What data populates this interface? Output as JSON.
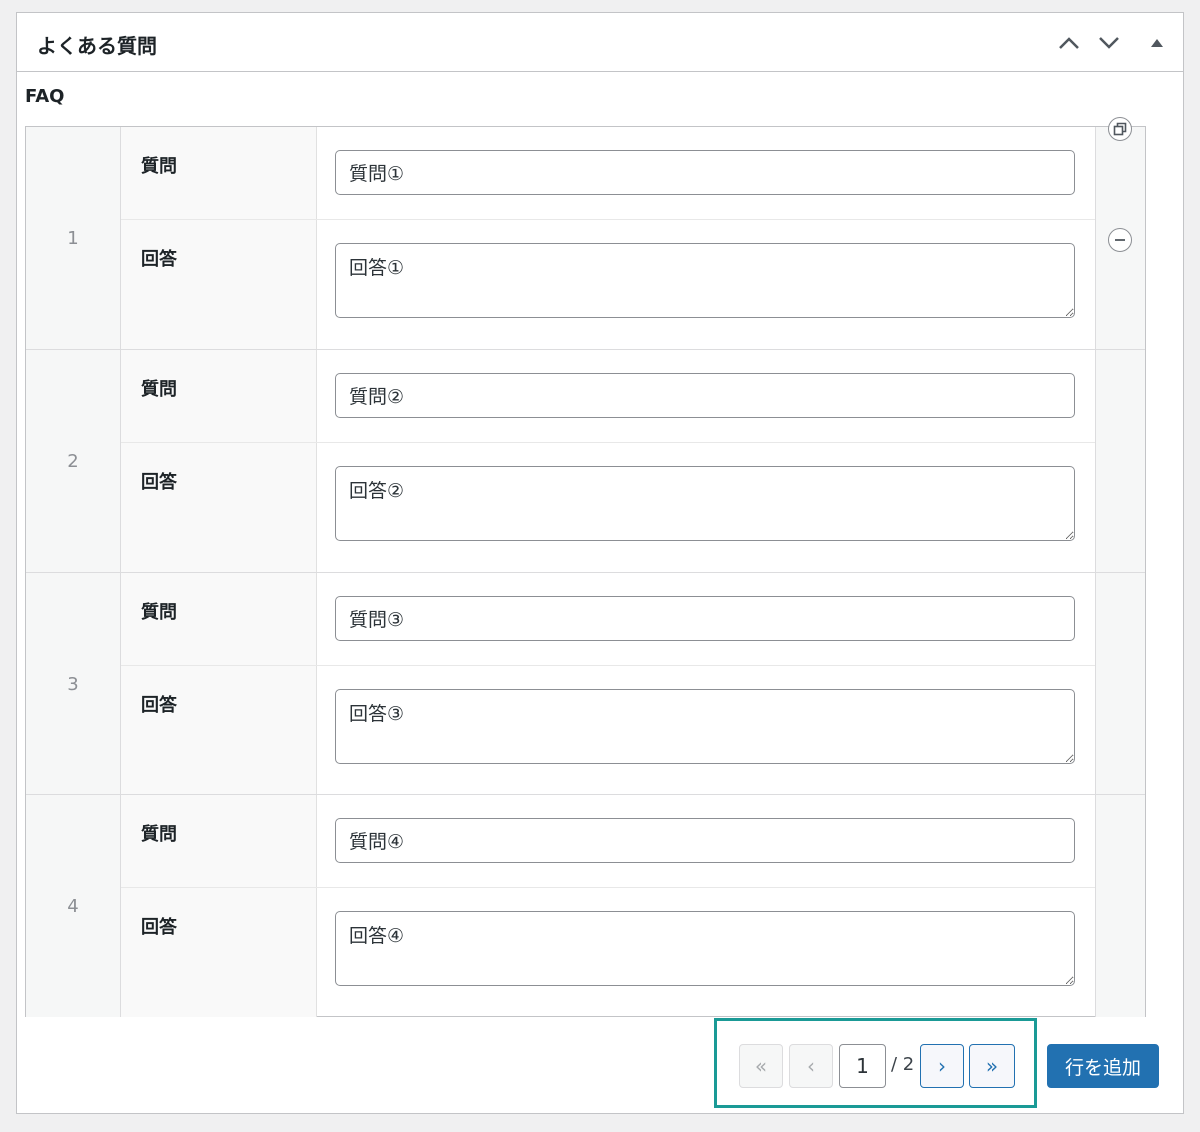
{
  "metabox": {
    "title": "よくある質問"
  },
  "field": {
    "label": "FAQ"
  },
  "rows": [
    {
      "index": "1",
      "question_label": "質問",
      "question_value": "質問①",
      "answer_label": "回答",
      "answer_value": "回答①"
    },
    {
      "index": "2",
      "question_label": "質問",
      "question_value": "質問②",
      "answer_label": "回答",
      "answer_value": "回答②"
    },
    {
      "index": "3",
      "question_label": "質問",
      "question_value": "質問③",
      "answer_label": "回答",
      "answer_value": "回答③"
    },
    {
      "index": "4",
      "question_label": "質問",
      "question_value": "質問④",
      "answer_label": "回答",
      "answer_value": "回答④"
    }
  ],
  "pagination": {
    "first": "«",
    "prev": "‹",
    "current": "1",
    "total": "/ 2",
    "next": "›",
    "last": "»"
  },
  "add_row_label": "行を追加",
  "colors": {
    "primary": "#2271b1",
    "highlight": "#1a9a96"
  }
}
